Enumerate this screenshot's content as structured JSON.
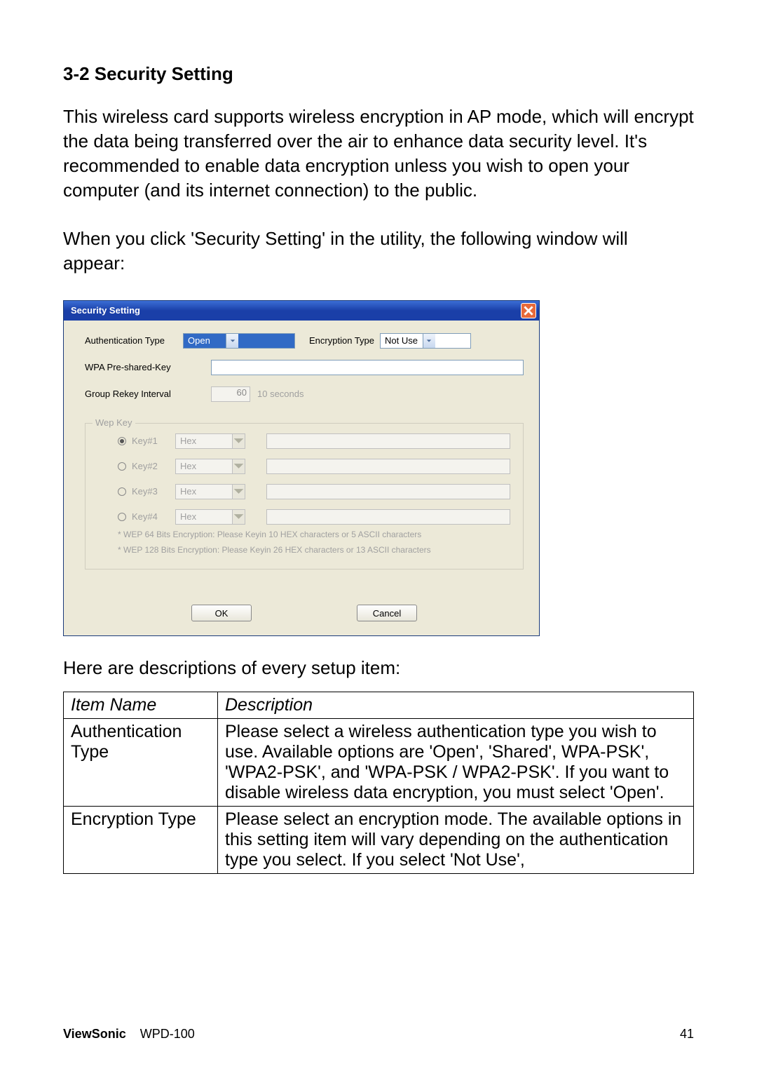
{
  "heading": "3-2 Security Setting",
  "para1": "This wireless card supports wireless encryption in AP mode, which will encrypt the data being transferred over the air to enhance data security level. It's recommended to enable data encryption unless you wish to open your computer (and its internet connection) to the public.",
  "para2": "When you click 'Security Setting' in the utility, the following window will appear:",
  "dialog": {
    "title": "Security Setting",
    "auth_label": "Authentication Type",
    "auth_value": "Open",
    "enc_label": "Encryption Type",
    "enc_value": "Not Use",
    "wpa_label": "WPA Pre-shared-Key",
    "rekey_label": "Group Rekey Interval",
    "rekey_value": "60",
    "rekey_unit": "10 seconds",
    "wep_legend": "Wep Key",
    "wep_keys": [
      {
        "label": "Key#1",
        "format": "Hex",
        "selected": true
      },
      {
        "label": "Key#2",
        "format": "Hex",
        "selected": false
      },
      {
        "label": "Key#3",
        "format": "Hex",
        "selected": false
      },
      {
        "label": "Key#4",
        "format": "Hex",
        "selected": false
      }
    ],
    "wep_note1": "* WEP 64 Bits Encryption: Please Keyin 10 HEX characters or 5 ASCII characters",
    "wep_note2": "* WEP 128 Bits Encryption: Please Keyin 26 HEX characters or 13 ASCII characters",
    "ok": "OK",
    "cancel": "Cancel"
  },
  "table_intro": "Here are descriptions of every setup item:",
  "table": {
    "h1": "Item Name",
    "h2": "Description",
    "rows": [
      {
        "name": "Authentication Type",
        "desc": "Please select a wireless authentication type you wish to use. Available options are 'Open', 'Shared', WPA-PSK', 'WPA2-PSK', and 'WPA-PSK / WPA2-PSK'. If you want to disable wireless data encryption, you must select 'Open'."
      },
      {
        "name": "Encryption Type",
        "desc": "Please select an encryption mode. The available options in this setting item will vary depending on the authentication type you select. If you select 'Not Use',"
      }
    ]
  },
  "footer": {
    "brand": "ViewSonic",
    "model": "WPD-100",
    "page": "41"
  }
}
